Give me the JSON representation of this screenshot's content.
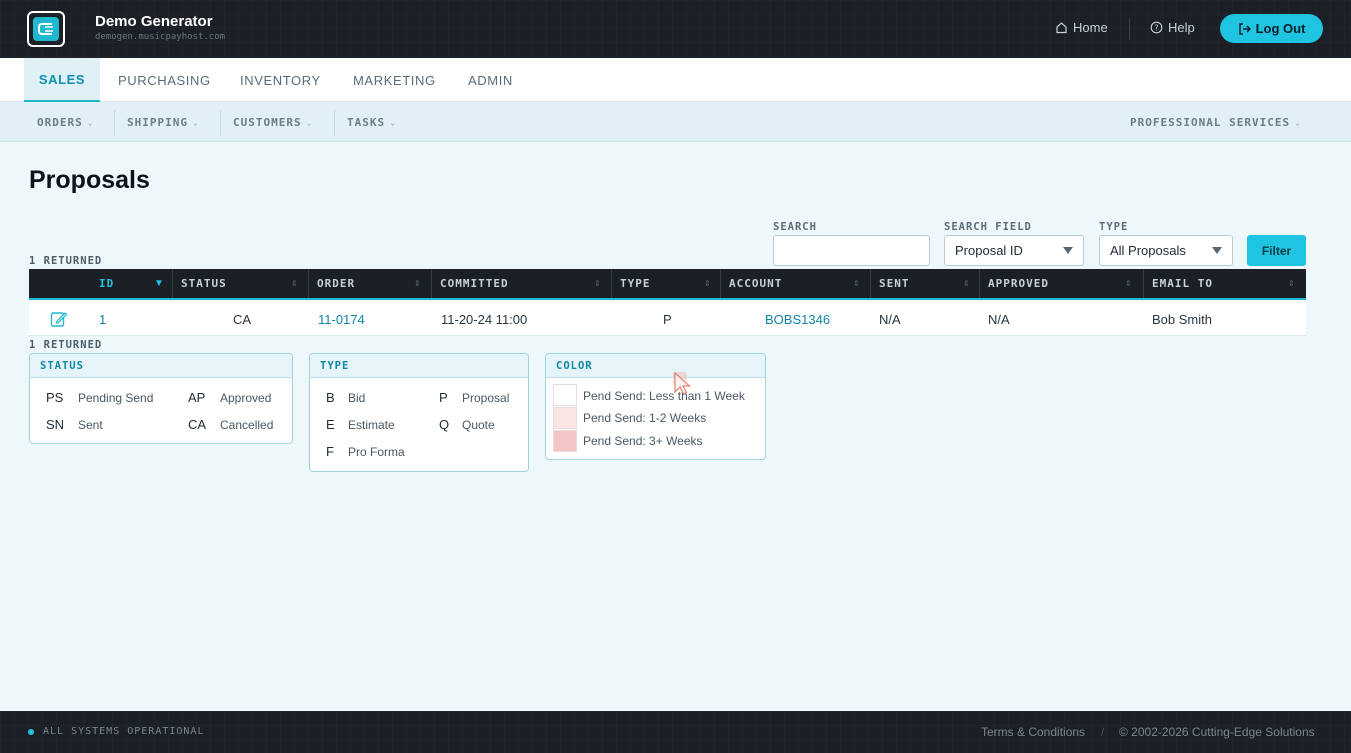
{
  "header": {
    "brand_title": "Demo Generator",
    "brand_subtitle": "demogen.musicpayhost.com",
    "home_label": "Home",
    "help_label": "Help",
    "logout_label": "Log Out",
    "accent_color": "#1fc5e0"
  },
  "main_nav": {
    "tabs": [
      {
        "label": "SALES",
        "active": true
      },
      {
        "label": "PURCHASING",
        "active": false
      },
      {
        "label": "INVENTORY",
        "active": false
      },
      {
        "label": "MARKETING",
        "active": false
      },
      {
        "label": "ADMIN",
        "active": false
      }
    ]
  },
  "sub_nav": {
    "items": [
      "ORDERS",
      "SHIPPING",
      "CUSTOMERS",
      "TASKS"
    ],
    "right_item": "PROFESSIONAL SERVICES"
  },
  "page": {
    "title": "Proposals"
  },
  "filters": {
    "search_label": "SEARCH",
    "search_value": "",
    "search_field_label": "SEARCH FIELD",
    "search_field_value": "Proposal ID",
    "type_label": "TYPE",
    "type_value": "All Proposals",
    "filter_button": "Filter"
  },
  "results": {
    "returned_top": "1 RETURNED",
    "returned_bottom": "1 RETURNED"
  },
  "table": {
    "sorted_column": "ID",
    "sort_direction": "descending",
    "columns": [
      "ID",
      "STATUS",
      "ORDER",
      "COMMITTED",
      "TYPE",
      "ACCOUNT",
      "SENT",
      "APPROVED",
      "EMAIL TO"
    ],
    "rows": [
      {
        "edit_icon": "edit-icon",
        "id": "1",
        "status": "CA",
        "order": "11-0174",
        "committed": "11-20-24 11:00",
        "type": "P",
        "account": "BOBS1346",
        "sent": "N/A",
        "approved": "N/A",
        "email_to": "Bob Smith"
      }
    ]
  },
  "legend_status": {
    "title": "STATUS",
    "items": [
      {
        "code": "PS",
        "desc": "Pending Send"
      },
      {
        "code": "AP",
        "desc": "Approved"
      },
      {
        "code": "SN",
        "desc": "Sent"
      },
      {
        "code": "CA",
        "desc": "Cancelled"
      }
    ]
  },
  "legend_type": {
    "title": "TYPE",
    "items": [
      {
        "code": "B",
        "desc": "Bid"
      },
      {
        "code": "P",
        "desc": "Proposal"
      },
      {
        "code": "E",
        "desc": "Estimate"
      },
      {
        "code": "Q",
        "desc": "Quote"
      },
      {
        "code": "F",
        "desc": "Pro Forma"
      }
    ]
  },
  "legend_color": {
    "title": "COLOR",
    "items": [
      {
        "label": "Pend Send: Less than 1 Week",
        "color": "#ffffff"
      },
      {
        "label": "Pend Send: 1-2 Weeks",
        "color": "#fbe4e4"
      },
      {
        "label": "Pend Send: 3+ Weeks",
        "color": "#f2c4c4"
      }
    ]
  },
  "footer": {
    "status": "ALL SYSTEMS OPERATIONAL",
    "terms": "Terms & Conditions",
    "copyright": "© 2002-2026 Cutting-Edge Solutions"
  }
}
